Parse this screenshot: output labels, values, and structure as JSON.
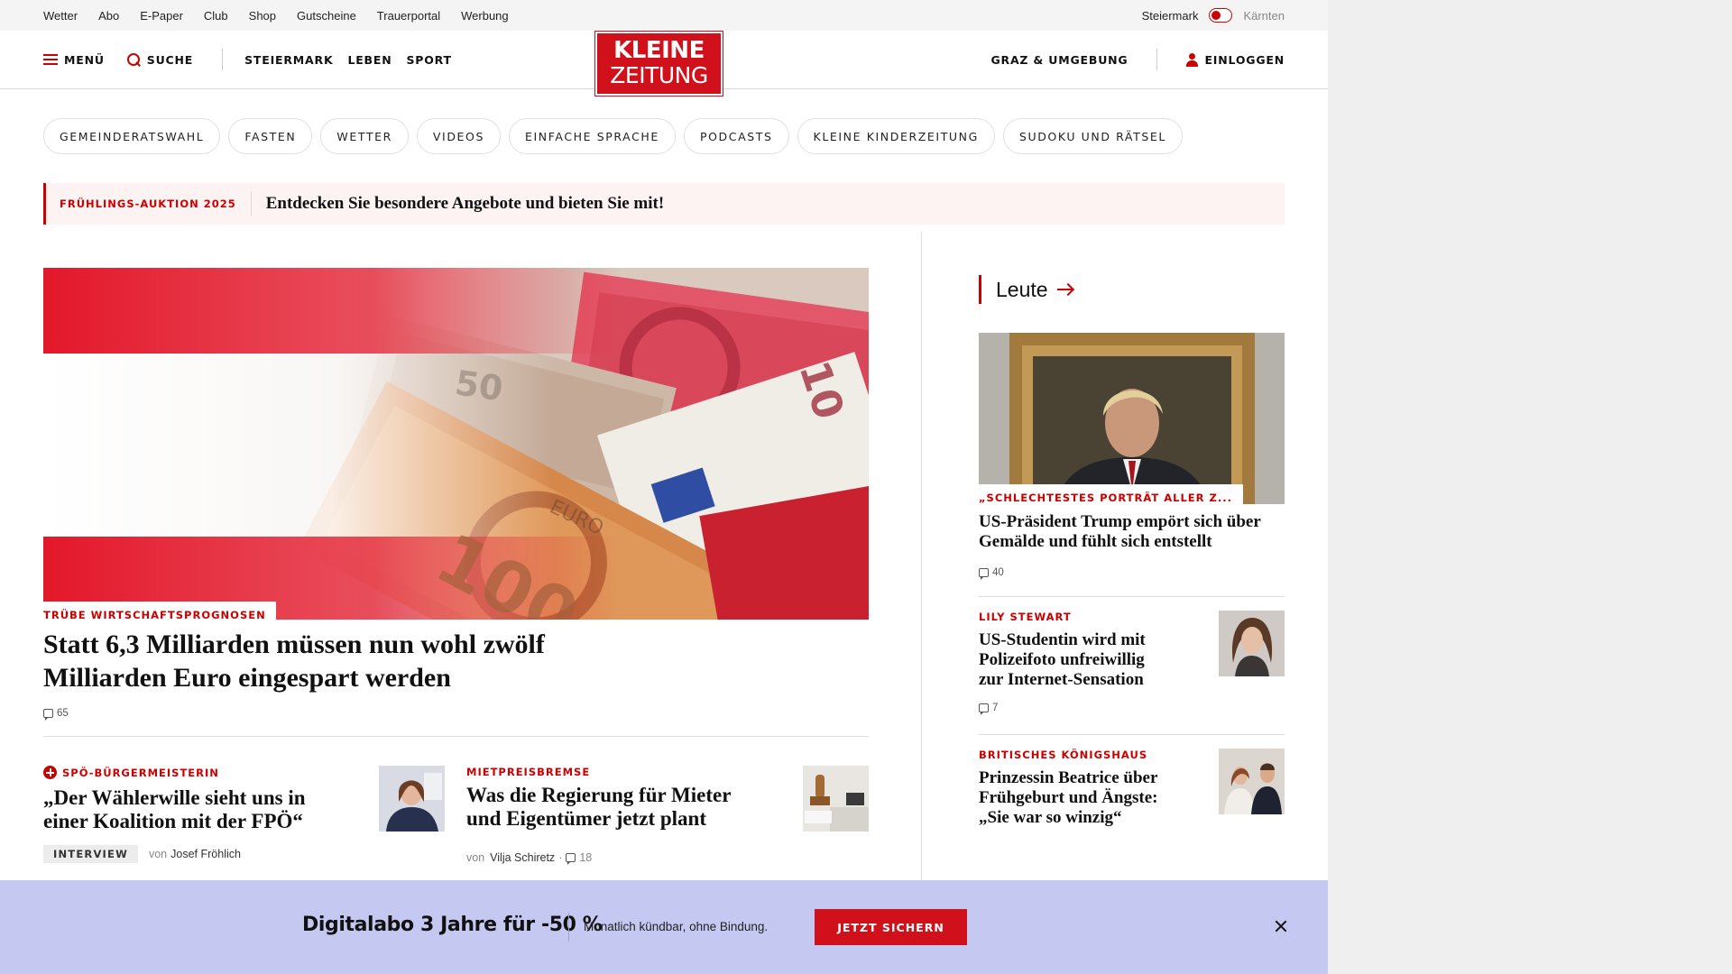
{
  "topbar": {
    "links": [
      "Wetter",
      "Abo",
      "E-Paper",
      "Club",
      "Shop",
      "Gutscheine",
      "Trauerportal",
      "Werbung"
    ],
    "region_active": "Steiermark",
    "region_inactive": "Kärnten"
  },
  "header": {
    "menu_label": "MENÜ",
    "search_label": "SUCHE",
    "nav": [
      "STEIERMARK",
      "LEBEN",
      "SPORT"
    ],
    "logo_line1": "KLEINE",
    "logo_line2": "ZEITUNG",
    "location": "GRAZ & UMGEBUNG",
    "login_label": "EINLOGGEN"
  },
  "chips": [
    "GEMEINDERATSWAHL",
    "FASTEN",
    "WETTER",
    "VIDEOS",
    "EINFACHE SPRACHE",
    "PODCASTS",
    "KLEINE KINDERZEITUNG",
    "SUDOKU UND RÄTSEL"
  ],
  "promo": {
    "kicker": "FRÜHLINGS-AUKTION 2025",
    "text": "Entdecken Sie besondere Angebote und bieten Sie mit!"
  },
  "hero": {
    "kicker": "TRÜBE WIRTSCHAFTSPROGNOSEN",
    "title": "Statt 6,3 Milliarden müssen nun wohl zwölf Milliarden Euro eingespart werden",
    "comments": "65",
    "banknote_labels": [
      "50",
      "100",
      "10",
      "EURO"
    ]
  },
  "teasers": [
    {
      "kicker": "SPÖ-BÜRGERMEISTERIN",
      "title": "„Der Wählerwille sieht uns in einer Koalition mit der FPÖ“",
      "tag": "INTERVIEW",
      "by": "von",
      "author": "Josef Fröhlich"
    },
    {
      "kicker": "MIETPREISBREMSE",
      "title": "Was die Regierung für Mieter und Eigentümer jetzt plant",
      "by": "von",
      "author": "Vilja Schiretz",
      "dot": "·",
      "comments": "18"
    }
  ],
  "sidebar": {
    "section": "Leute",
    "lead": {
      "kicker": "„SCHLECHTESTES PORTRÄT ALLER Z...",
      "title": "US-Präsident Trump empört sich über Gemälde und fühlt sich entstellt",
      "comments": "40"
    },
    "items": [
      {
        "kicker": "LILY STEWART",
        "title": "US-Studentin wird mit Polizeifoto unfreiwillig zur Internet-Sensation",
        "comments": "7"
      },
      {
        "kicker": "BRITISCHES KÖNIGSHAUS",
        "title": "Prinzessin Beatrice über Frühgeburt und Ängste: „Sie war so winzig“"
      }
    ]
  },
  "subscribe": {
    "title": "Digitalabo 3 Jahre für -50 %",
    "text": "Monatlich kündbar, ohne Bindung.",
    "button": "JETZT SICHERN"
  },
  "colors": {
    "brand_red": "#d0111b",
    "banner_bg": "#c5c9f1",
    "promo_bg": "#fdf3f3"
  }
}
